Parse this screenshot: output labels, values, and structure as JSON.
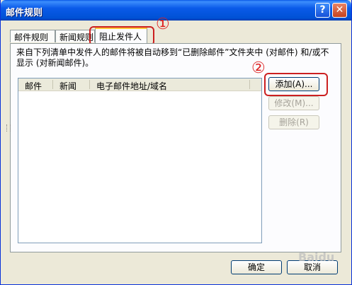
{
  "window": {
    "title": "邮件规则",
    "help_glyph": "?",
    "close_glyph": "✕"
  },
  "tabs": [
    {
      "label": "邮件规则"
    },
    {
      "label": "新闻规则"
    },
    {
      "label": "阻止发件人"
    }
  ],
  "annotations": {
    "mark1": "①",
    "mark2": "②"
  },
  "panel": {
    "description": "来自下列清单中发件人的邮件将被自动移到“已删除邮件”文件夹中 (对邮件) 和/或不显示 (对新闻邮件)。",
    "columns": [
      "邮件",
      "新闻",
      "电子邮件地址/域名"
    ],
    "rows": []
  },
  "buttons": {
    "add": "添加(A)...",
    "modify": "修改(M)...",
    "delete": "删除(R)",
    "ok": "确定",
    "cancel": "取消"
  },
  "watermark": "Baidu"
}
